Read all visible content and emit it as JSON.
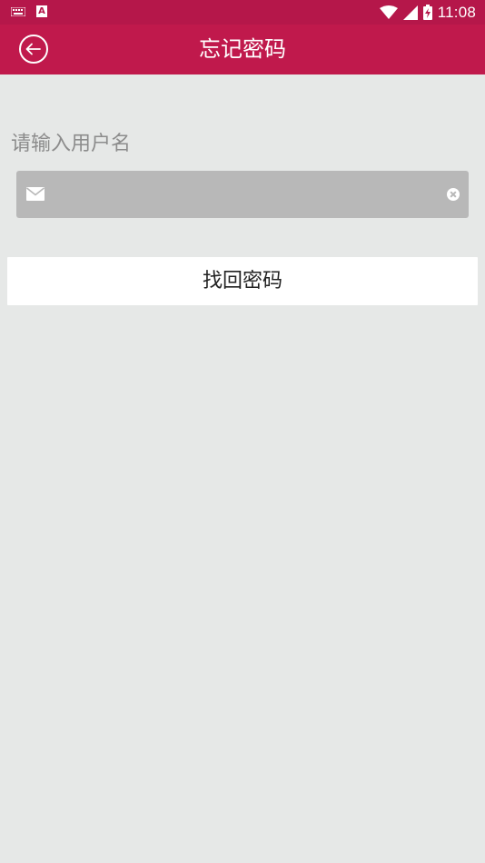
{
  "status_bar": {
    "time": "11:08",
    "notification_icons": [
      "keyboard-icon",
      "a-icon"
    ],
    "system_icons": [
      "wifi-icon",
      "cell-signal-icon",
      "battery-charging-icon"
    ],
    "a_icon_letter": "A"
  },
  "header": {
    "title": "忘记密码",
    "back_icon": "back-arrow-circle-icon",
    "background": "#c0194c"
  },
  "form": {
    "username_label": "请输入用户名",
    "username_value": "",
    "username_placeholder": "",
    "input_icon": "mail-icon",
    "clear_icon": "clear-icon",
    "submit_label": "找回密码"
  },
  "colors": {
    "accent": "#c0194c",
    "page_background": "#e6e8e7",
    "input_background": "#b8b8b8"
  }
}
